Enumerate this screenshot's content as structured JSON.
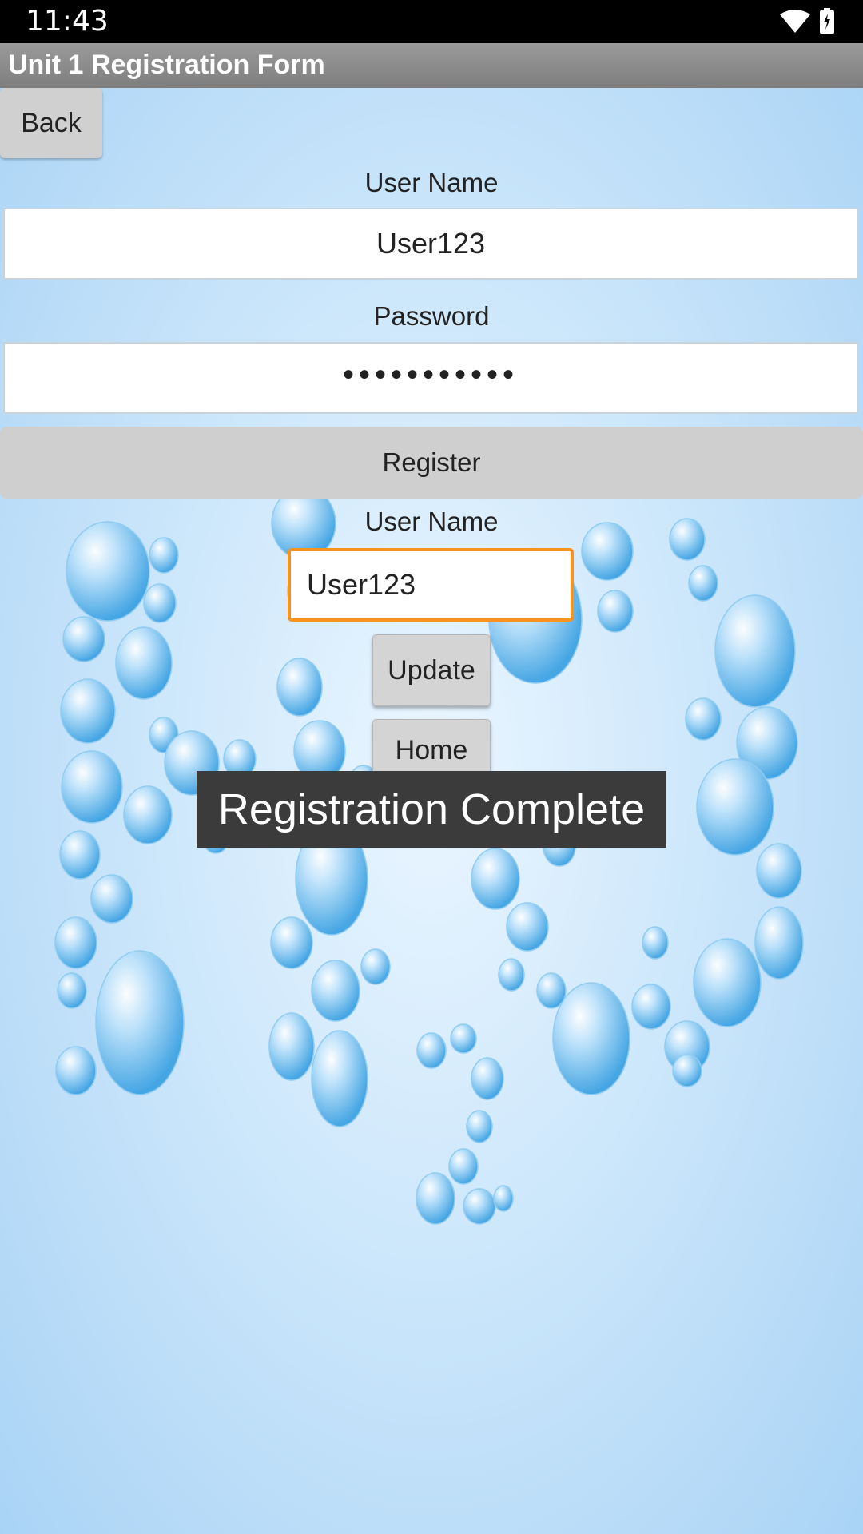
{
  "status_bar": {
    "time": "11:43"
  },
  "header": {
    "title": "Unit 1 Registration Form"
  },
  "toolbar": {
    "back_label": "Back"
  },
  "form": {
    "username_label": "User Name",
    "username_value": "User123",
    "password_label": "Password",
    "password_value": "•••••••••••",
    "register_label": "Register"
  },
  "update_section": {
    "username_label": "User Name",
    "username_value": "User123",
    "update_label": "Update",
    "home_label": "Home"
  },
  "toast": {
    "message": "Registration Complete"
  },
  "colors": {
    "accent_border": "#f7931e",
    "title_bar": "#8a8a8a",
    "bubble": "#5fb4ea",
    "toast_bg": "#3b3b3b"
  }
}
